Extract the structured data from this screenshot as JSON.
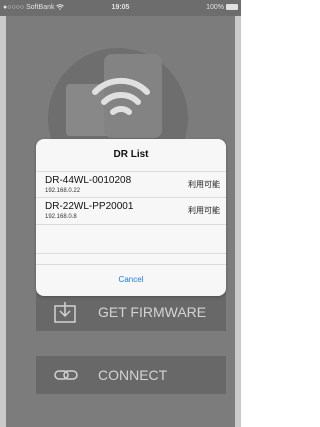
{
  "status_bar": {
    "signal": "●○○○○",
    "carrier": "SoftBank",
    "wifi": "wifi-icon",
    "time": "19:05",
    "battery": "100%"
  },
  "buttons": {
    "firmware": "GET FIRMWARE",
    "connect": "CONNECT"
  },
  "dialog": {
    "title": "DR List",
    "devices": [
      {
        "name": "DR-44WL-0010208",
        "ip": "192.168.0.22",
        "status": "利用可能"
      },
      {
        "name": "DR-22WL-PP20001",
        "ip": "192.168.0.8",
        "status": "利用可能"
      }
    ],
    "cancel": "Cancel"
  },
  "colors": {
    "accent": "#1a7cf0",
    "background": "#8e8e8e"
  }
}
